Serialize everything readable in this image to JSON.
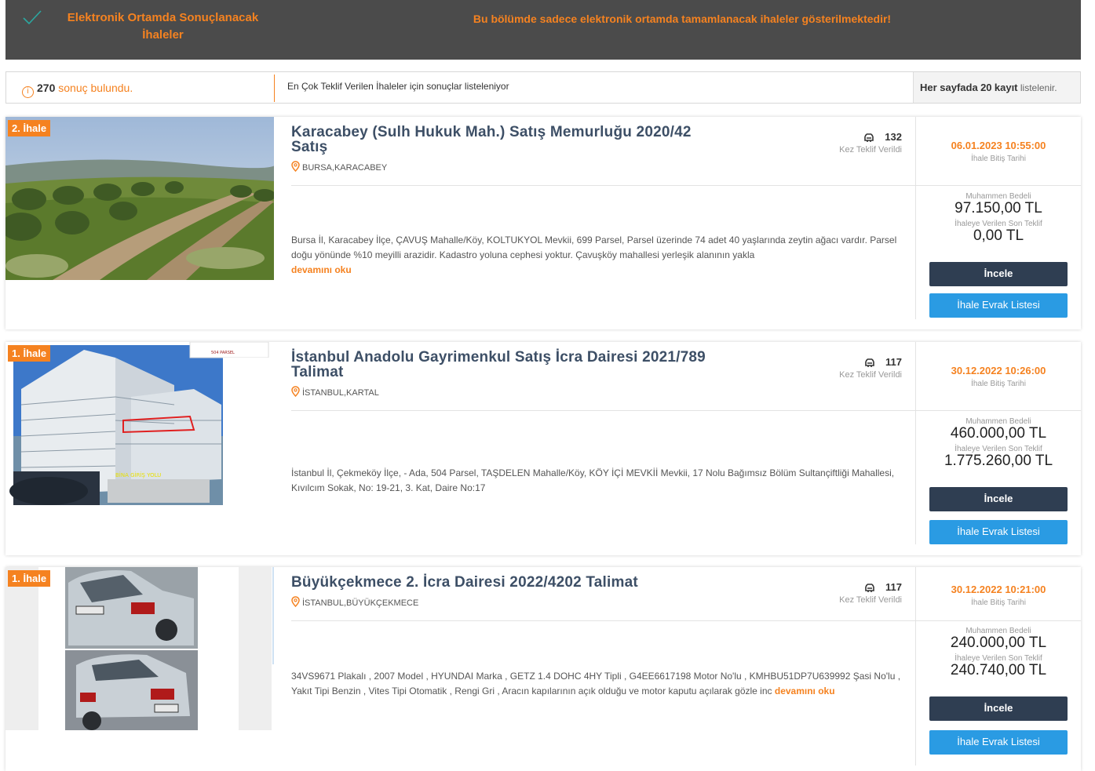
{
  "banner": {
    "title": "Elektronik Ortamda Sonuçlanacak İhaleler",
    "message": "Bu bölümde sadece elektronik ortamda tamamlanacak ihaleler gösterilmektedir!"
  },
  "results": {
    "count": "270",
    "count_suffix": "sonuç bulundu.",
    "sort_prefix": "En Çok Teklif Verilen İhaleler",
    "sort_suffix": "için sonuçlar listeleniyor",
    "perpage_prefix": "Her sayfada",
    "perpage_count": "20",
    "perpage_middle": "kayıt",
    "perpage_suffix": "listelenir."
  },
  "labels": {
    "bid_count": "Kez Teklif Verildi",
    "end_date": "İhale Bitiş Tarihi",
    "estimated": "Muhammen Bedeli",
    "last_bid": "İhaleye Verilen Son Teklif",
    "inspect": "İncele",
    "documents": "İhale Evrak Listesi",
    "read_more": "devamını oku"
  },
  "colors": {
    "accent": "#f58220",
    "banner_bg": "#4b4b4b",
    "dark_button": "#2f3e52",
    "blue_button": "#2a9be3"
  },
  "listings": [
    {
      "badge": "2. İhale",
      "title": "Karacabey (Sulh Hukuk Mah.) Satış Memurluğu 2020/42 Satış",
      "location": "BURSA,KARACABEY",
      "bids": "132",
      "description": "Bursa İl, Karacabey İlçe, ÇAVUŞ Mahalle/Köy, KOLTUKYOL Mevkii, 699 Parsel, Parsel üzerinde 74 adet 40 yaşlarında zeytin ağacı vardır. Parsel doğu yönünde %10 meyilli arazidir. Kadastro yoluna cephesi yoktur. Çavuşköy mahallesi yerleşik alanının yakla",
      "end_date": "06.01.2023 10:55:00",
      "estimated_price": "97.150,00 TL",
      "last_bid": "0,00 TL",
      "image": "olive-grove-photo"
    },
    {
      "badge": "1. İhale",
      "title": "İstanbul Anadolu Gayrimenkul Satış İcra Dairesi 2021/789 Talimat",
      "location": "İSTANBUL,KARTAL",
      "bids": "117",
      "description": "İstanbul İl, Çekmeköy İlçe, - Ada, 504 Parsel, TAŞDELEN Mahalle/Köy, KÖY İÇİ MEVKİİ Mevkii, 17 Nolu Bağımsız Bölüm Sultançiftliği Mahallesi, Kıvılcım Sokak, No: 19-21, 3. Kat, Daire No:17",
      "end_date": "30.12.2022 10:26:00",
      "estimated_price": "460.000,00 TL",
      "last_bid": "1.775.260,00 TL",
      "image": "apartment-building-photo",
      "image_note": "BİNA GİRİŞ YOLU",
      "image_note_top": "504 PARSEL"
    },
    {
      "badge": "1. İhale",
      "title": "Büyükçekmece 2. İcra Dairesi 2022/4202 Talimat",
      "location": "İSTANBUL,BÜYÜKÇEKMECE",
      "bids": "117",
      "description": "34VS9671 Plakalı , 2007 Model , HYUNDAI Marka , GETZ 1.4 DOHC 4HY Tipli , G4EE6617198 Motor No'lu , KMHBU51DP7U639992 Şasi No'lu , Yakıt Tipi Benzin , Vites Tipi Otomatik , Rengi Gri , Aracın kapılarının açık olduğu ve motor kaputu açılarak gözle inc",
      "end_date": "30.12.2022 10:21:00",
      "estimated_price": "240.000,00 TL",
      "last_bid": "240.740,00 TL",
      "image": "car-photo"
    }
  ]
}
